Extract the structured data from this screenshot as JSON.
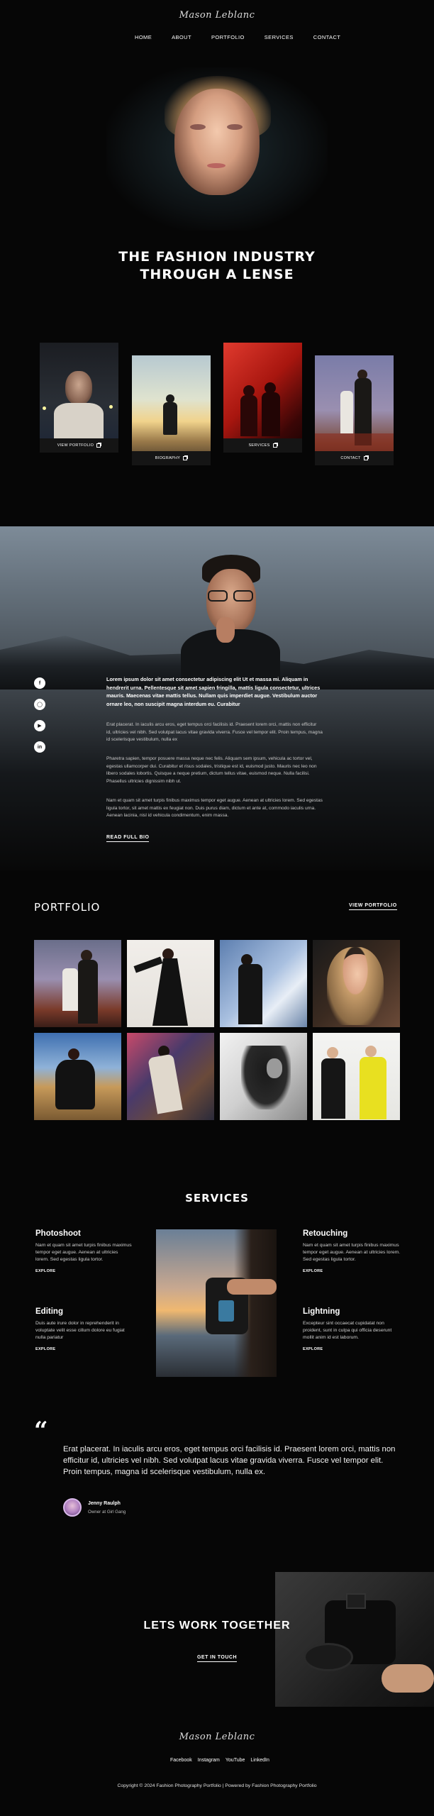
{
  "header": {
    "logo": "Mason Leblanc",
    "nav": [
      "HOME",
      "ABOUT",
      "PORTFOLIO",
      "SERVICES",
      "CONTACT"
    ]
  },
  "hero": {
    "title_line1": "THE FASHION INDUSTRY",
    "title_line2": "THROUGH A LENSE",
    "cards": [
      {
        "label": "VIEW PORTFOLIO"
      },
      {
        "label": "BIOGRAPHY"
      },
      {
        "label": "SERVICES"
      },
      {
        "label": "CONTACT"
      }
    ]
  },
  "bio": {
    "social_icons": [
      "facebook-icon",
      "instagram-icon",
      "youtube-icon",
      "linkedin-icon"
    ],
    "lead": "Lorem ipsum dolor sit amet consectetur adipiscing elit Ut et massa mi. Aliquam in hendrerit urna. Pellentesque sit amet sapien fringilla, mattis ligula consectetur, ultrices mauris. Maecenas vitae mattis tellus. Nullam quis imperdiet augue. Vestibulum auctor ornare leo, non suscipit magna interdum eu. Curabitur",
    "p1": "Erat placerat. In iaculis arcu eros, eget tempus orci facilisis id. Praesent lorem orci, mattis non efficitur id, ultricies vel nibh. Sed volutpat lacus vitae gravida viverra. Fusce vel tempor elit. Proin tempus, magna id scelerisque vestibulum, nulla ex",
    "p2": "Pharetra sapien, tempor posuere massa neque nec felis. Aliquam sem ipsum, vehicula ac tortor vel, egestas ullamcorper dui. Curabitur et risus sodales, tristique est id, euismod justo. Mauris nec leo non libero sodales lobortis. Quisque a neque pretium, dictum tellus vitae, euismod neque. Nulla facilisi. Phasellus ultricies dignissim nibh ut.",
    "p3": "Nam et quam sit amet turpis finibus maximus tempor eget augue. Aenean at ultricies lorem. Sed egestas ligula tortor, sit amet mattis ex feugiat non. Duis purus diam, dictum et ante at, commodo iaculis urna. Aenean lacinia, nisl id vehicula condimentum, enim massa.",
    "read_more": "READ FULL BIO"
  },
  "portfolio": {
    "title": "PORTFOLIO",
    "view_all": "VIEW PORTFOLIO"
  },
  "services": {
    "title": "SERVICES",
    "items": [
      {
        "title": "Photoshoot",
        "text": "Nam et quam sit amet turpis finibus maximus tempor eget augue. Aenean at ultricies lorem. Sed egestas ligula tortor.",
        "link": "EXPLORE"
      },
      {
        "title": "Retouching",
        "text": "Nam et quam sit amet turpis finibus maximus tempor eget augue. Aenean at ultricies lorem. Sed egestas ligula tortor.",
        "link": "EXPLORE"
      },
      {
        "title": "Editing",
        "text": "Duis aute irure dolor in reprehenderit in voluptate velit esse cillum dolore eu fugiat nulla pariatur",
        "link": "EXPLORE"
      },
      {
        "title": "Lightning",
        "text": "Excepteur sint occaecat cupidatat non proident, sunt in culpa qui officia deserunt mollit anim id est laborum.",
        "link": "EXPLORE"
      }
    ]
  },
  "testimonial": {
    "quote_mark": "“",
    "text": "Erat placerat. In iaculis arcu eros, eget tempus orci facilisis id. Praesent lorem orci, mattis non efficitur id, ultricies vel nibh. Sed volutpat lacus vitae gravida viverra. Fusce vel tempor elit. Proin tempus, magna id scelerisque vestibulum, nulla ex.",
    "name": "Jenny Raulph",
    "role": "Owner at Girl Gang"
  },
  "cta": {
    "title": "LETS WORK TOGETHER",
    "button": "GET IN TOUCH"
  },
  "footer": {
    "logo": "Mason Leblanc",
    "links": [
      "Facebook",
      "Instagram",
      "YouTube",
      "LinkedIn"
    ],
    "copyright": "Copyright © 2024 Fashion Photography Portfolio | Powered by Fashion Photography Portfolio"
  }
}
